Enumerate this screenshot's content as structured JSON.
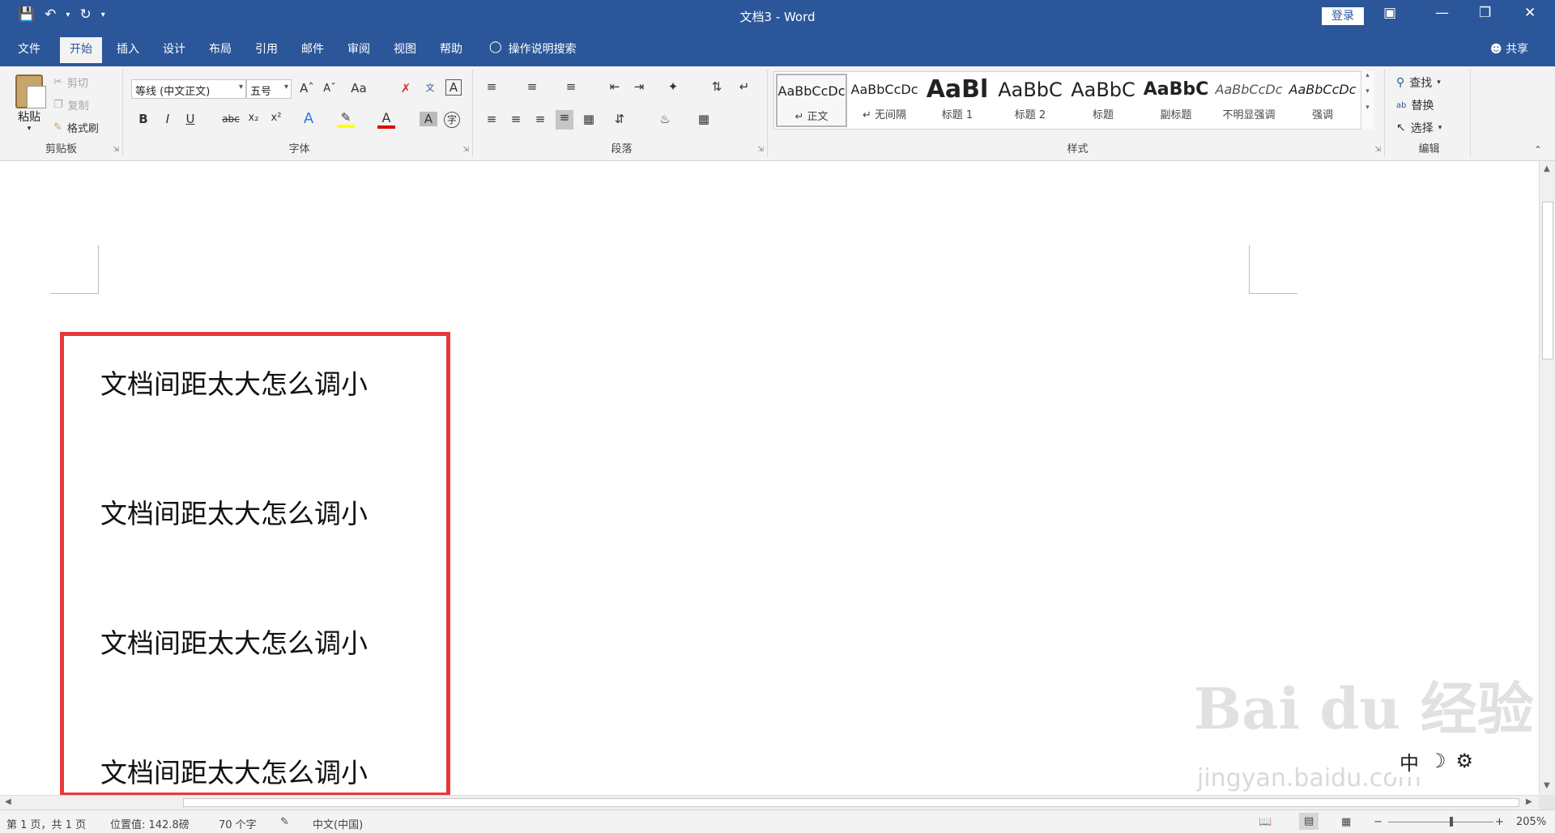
{
  "window": {
    "title": "文档3  -  Word",
    "login_label": "登录"
  },
  "tabs": [
    "文件",
    "开始",
    "插入",
    "设计",
    "布局",
    "引用",
    "邮件",
    "审阅",
    "视图",
    "帮助"
  ],
  "help_search": "操作说明搜索",
  "share_label": "共享",
  "clipboard": {
    "paste": "粘贴",
    "cut": "剪切",
    "copy": "复制",
    "format_painter": "格式刷",
    "label": "剪贴板"
  },
  "font": {
    "name": "等线 (中文正文)",
    "size": "五号",
    "label": "字体"
  },
  "paragraph": {
    "label": "段落"
  },
  "styles": {
    "label": "样式",
    "items": [
      {
        "preview": "AaBbCcDc",
        "name": "↵ 正文"
      },
      {
        "preview": "AaBbCcDc",
        "name": "↵ 无间隔"
      },
      {
        "preview": "AaBl",
        "name": "标题 1"
      },
      {
        "preview": "AaBbC",
        "name": "标题 2"
      },
      {
        "preview": "AaBbC",
        "name": "标题"
      },
      {
        "preview": "AaBbC",
        "name": "副标题"
      },
      {
        "preview": "AaBbCcDc",
        "name": "不明显强调"
      },
      {
        "preview": "AaBbCcDc",
        "name": "强调"
      }
    ]
  },
  "editing": {
    "find": "查找",
    "replace": "替换",
    "select": "选择",
    "label": "编辑"
  },
  "document": {
    "lines": [
      "文档间距太大怎么调小",
      "文档间距太大怎么调小",
      "文档间距太大怎么调小",
      "文档间距太大怎么调小"
    ]
  },
  "status": {
    "page": "第 1 页，共 1 页",
    "position": "位置值: 142.8磅",
    "words": "70 个字",
    "language": "中文(中国)",
    "zoom": "205%"
  },
  "ime": {
    "mode": "中"
  },
  "watermark": {
    "brand": "Bai du 经验",
    "url": "jingyan.baidu.com"
  }
}
